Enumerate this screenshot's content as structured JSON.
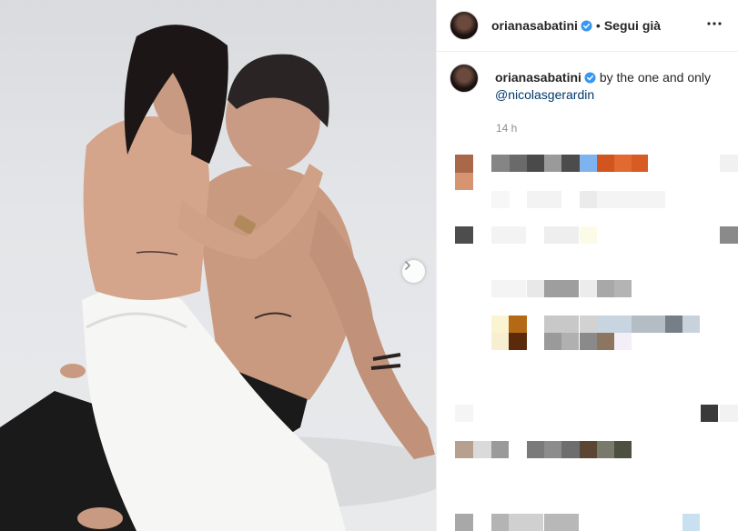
{
  "post": {
    "author": "orianasabatini",
    "follow_status": "Segui già",
    "separator": "•",
    "caption_text": "by the one and only",
    "caption_mention": "@nicolasgerardin",
    "timestamp": "14 h"
  },
  "colors": {
    "verified": "#3897f0",
    "text": "#262626",
    "secondary": "#8e8e8e",
    "link": "#00376b"
  },
  "icons": {
    "verified": "verified-badge-icon",
    "more": "more-options-icon",
    "next": "chevron-right-icon"
  }
}
